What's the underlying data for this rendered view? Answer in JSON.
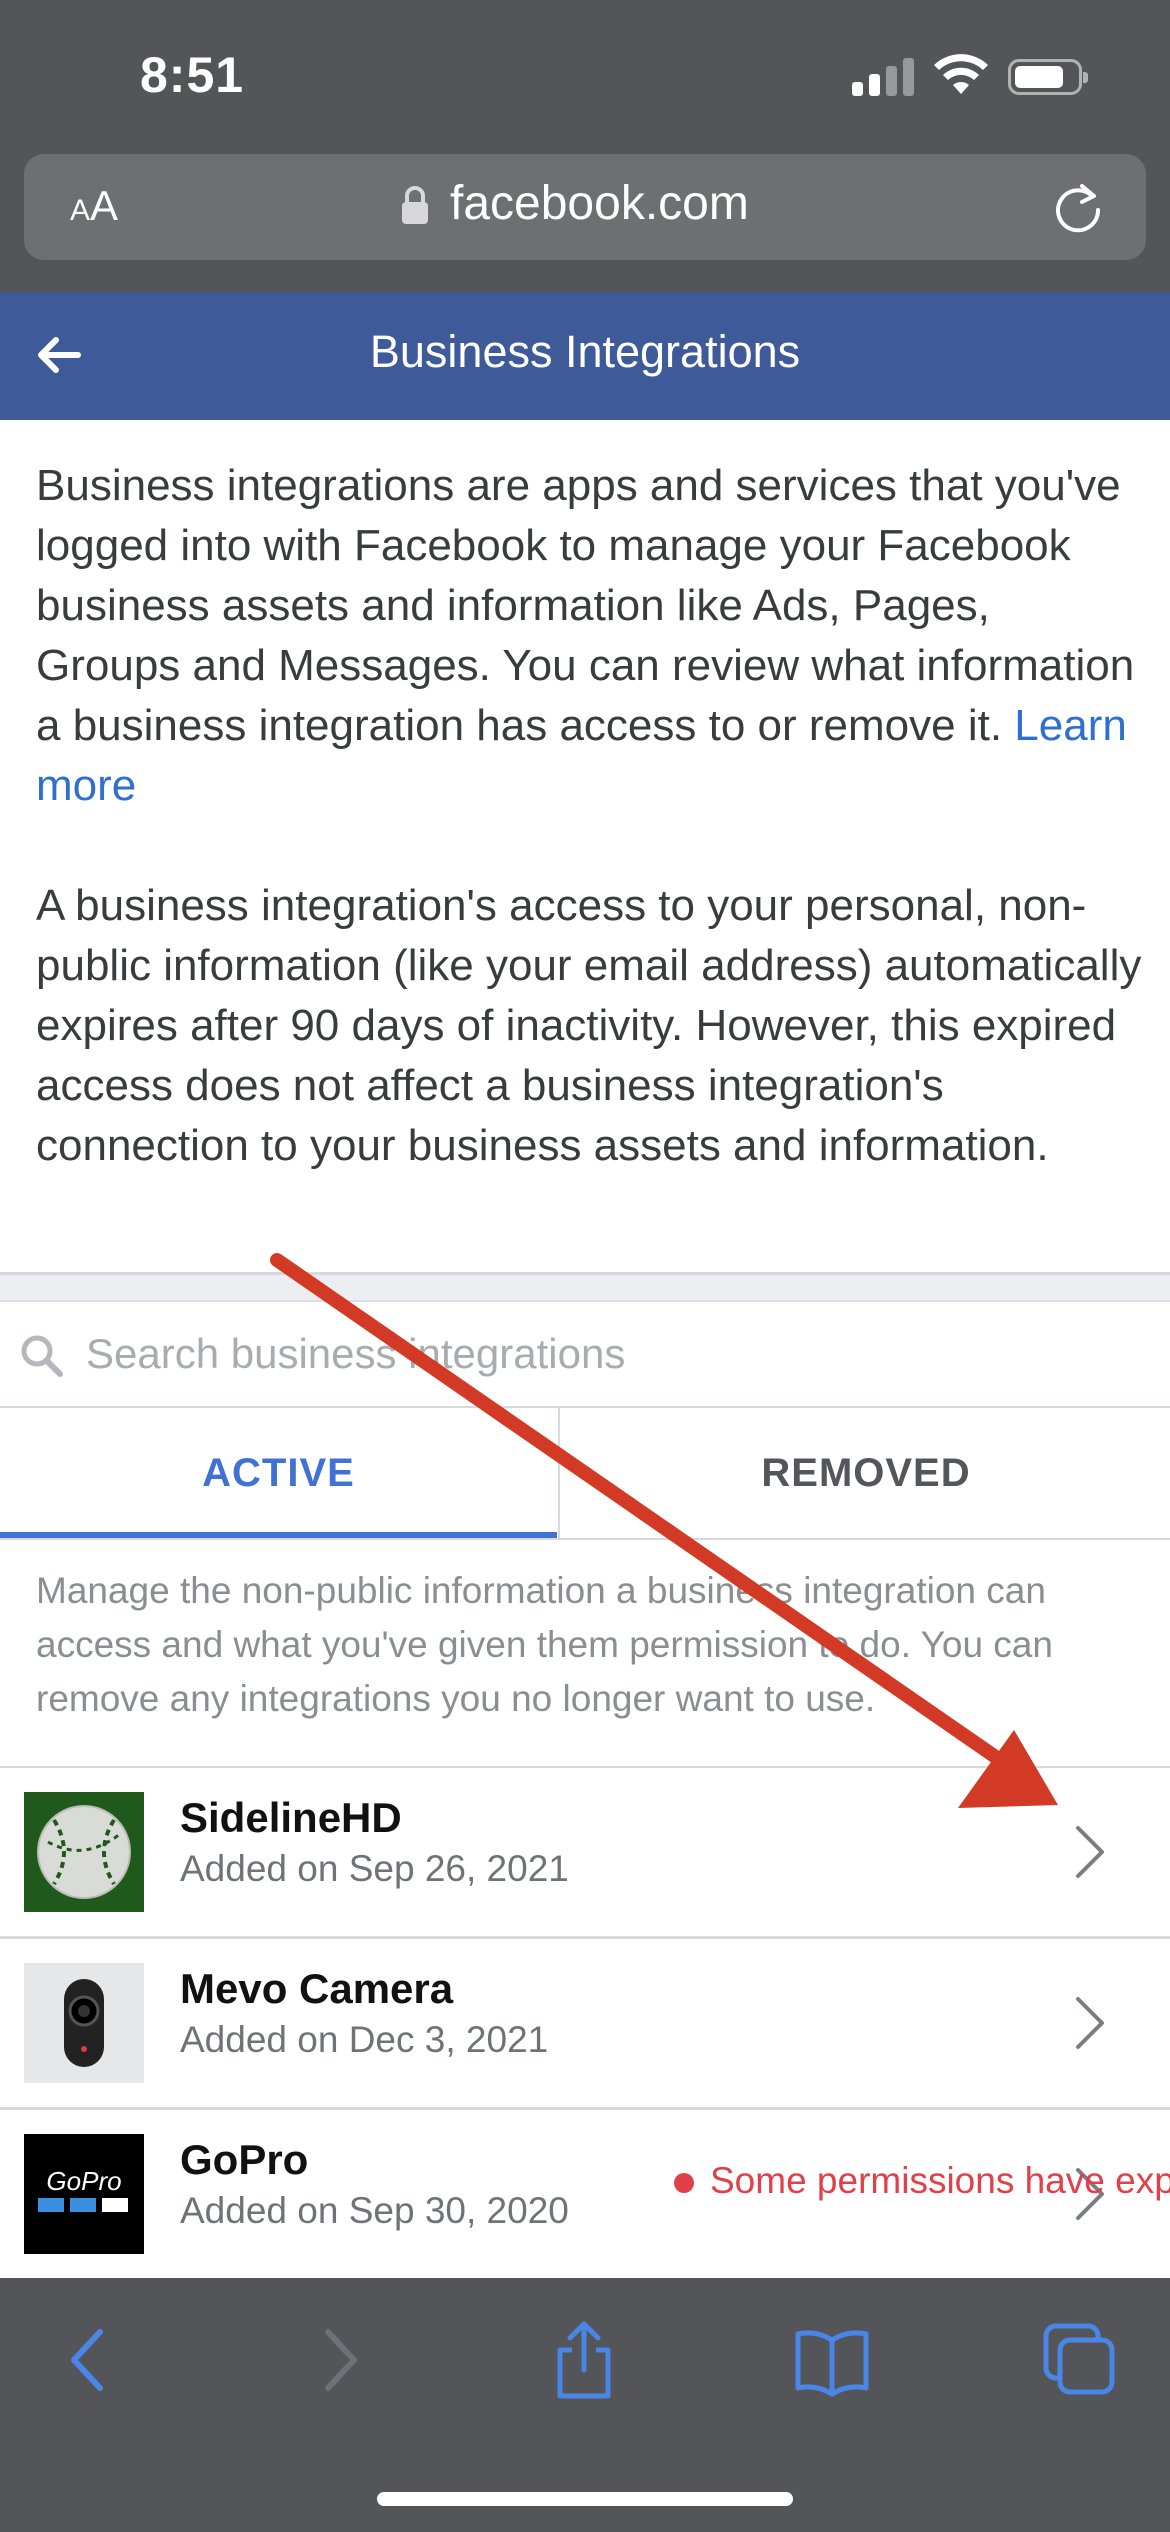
{
  "status_bar": {
    "time": "8:51"
  },
  "browser": {
    "text_size_label": "AA",
    "url": "facebook.com"
  },
  "header": {
    "title": "Business Integrations"
  },
  "description": {
    "paragraph1": "Business integrations are apps and services that you've logged into with Facebook to manage your Facebook business assets and information like Ads, Pages, Groups and Messages. You can review what information a business integration has access to or remove it.",
    "learn_more": "Learn more",
    "paragraph2": "A business integration's access to your personal, non-public information (like your email address) automatically expires after 90 days of inactivity. However, this expired access does not affect a business integration's connection to your business assets and information."
  },
  "search": {
    "placeholder": "Search business integrations"
  },
  "tabs": [
    {
      "label": "ACTIVE",
      "active": true
    },
    {
      "label": "REMOVED",
      "active": false
    }
  ],
  "info_text": "Manage the non-public information a business integration can access and what you've given them permission to do. You can remove any integrations you no longer want to use.",
  "integrations": [
    {
      "name": "SidelineHD",
      "date": "Added on Sep 26, 2021",
      "icon": "baseball-icon"
    },
    {
      "name": "Mevo Camera",
      "date": "Added on Dec 3, 2021",
      "icon": "camera-device-icon"
    },
    {
      "name": "GoPro",
      "date": "Added on Sep 30, 2020",
      "icon": "gopro-logo",
      "warning": "Some permissions have exp"
    }
  ],
  "colors": {
    "fb_blue": "#3f5a99",
    "link_blue": "#2f6fcf",
    "tab_active": "#4271d6",
    "warning_red": "#e0404a",
    "annotation_arrow": "#d23a26"
  }
}
